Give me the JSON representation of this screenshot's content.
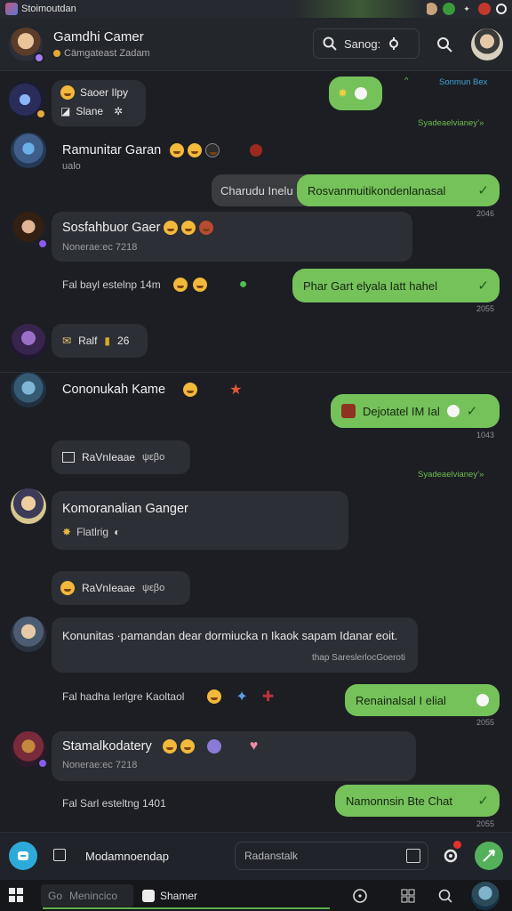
{
  "system": {
    "app_title": "Stoimoutdan",
    "tray_icons": [
      "avatar-icon",
      "green-app-icon",
      "sword-icon",
      "shield-icon",
      "circle-icon"
    ]
  },
  "header": {
    "title": "Gamdhi Camer",
    "subtitle": "Cämgateast Zadam",
    "search_label": "Sanog:",
    "status_color": "#e5a93a"
  },
  "top_bubble": {
    "green_hint": "Sonmun Bex",
    "arrow": "^"
  },
  "messages": [
    {
      "type": "in",
      "lines": [
        "Saoer Ilpy",
        "Slane"
      ]
    },
    {
      "type": "green-label",
      "text": "Syadeaelvianey’»"
    },
    {
      "type": "name",
      "name": "Ramunitar Garan"
    },
    {
      "type": "name-sub",
      "text": "ualo"
    },
    {
      "type": "ghost",
      "text": "Charudu Inelu"
    },
    {
      "type": "out",
      "text": "Rosvanmuitikondenlanasal",
      "time": "2046"
    },
    {
      "type": "in-card",
      "name": "Sosfahbuor Gaer",
      "sub": "Nonerae:ec 7218"
    },
    {
      "type": "line",
      "text": "Fal bayl estelnp 14m"
    },
    {
      "type": "out",
      "text": "Phar Gart elyala Iatt hahel",
      "time": "2055"
    },
    {
      "type": "pill",
      "text": "Ralf",
      "count": "26"
    },
    {
      "type": "name",
      "name": "Cononukah Kame"
    },
    {
      "type": "out",
      "text": "Dejotatel IM Ial",
      "time": "1043"
    },
    {
      "type": "pill-icon",
      "text": "RaVnIeaae",
      "extra": "ψεβο"
    },
    {
      "type": "green-label",
      "text": "Syadeaelvianey’»"
    },
    {
      "type": "in-card",
      "name": "Komoranalian Ganger",
      "sub": "Flatlrig"
    },
    {
      "type": "pill-emoji",
      "text": "RaVnIeaae",
      "extra": "ψεβο"
    },
    {
      "type": "in-long",
      "text": "Konunitas ·pamandan dear dormiucka n Ikaok sapam Idanar eoit.",
      "footer": "thap SareslerlocGoeroti"
    },
    {
      "type": "line",
      "text": "Fal hadha Ierlgre Kaoltaol"
    },
    {
      "type": "out",
      "text": "Renainalsal I elial",
      "time": "2055"
    },
    {
      "type": "in-card",
      "name": "Stamalkodatery",
      "sub": "Nonerae:ec 7218"
    },
    {
      "type": "line",
      "text": "Fal Sarl esteltng 1401"
    },
    {
      "type": "out",
      "text": "Namonnsin Bte Chat",
      "time": "2055"
    }
  ],
  "composer": {
    "label": "Modamnoendap",
    "placeholder": "Radanstalk",
    "badge": "!"
  },
  "taskbar": {
    "search_prefix": "Go",
    "search_text": "Menincico",
    "app_label": "Shamer",
    "progress_percent": 56
  },
  "colors": {
    "out_bubble": "#75c25b",
    "in_bubble": "#2c2f35",
    "accent_green": "#6ebd4e",
    "background": "#1c1e23"
  }
}
